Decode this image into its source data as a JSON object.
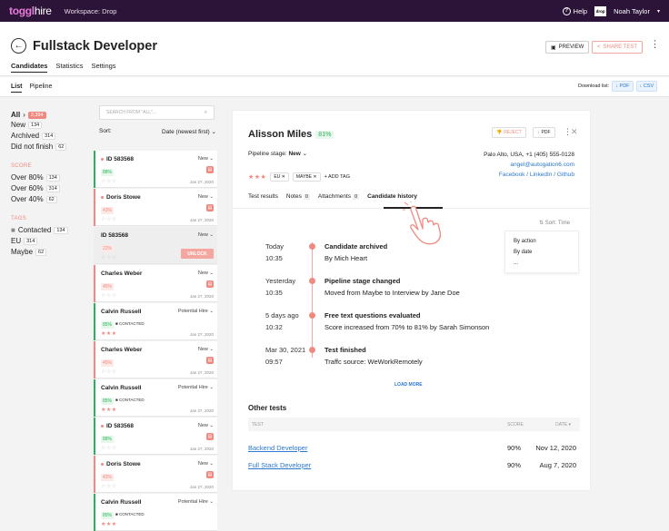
{
  "topbar": {
    "logo_main": "toggl",
    "logo_sub": "hire",
    "workspace": "Workspace: Drop",
    "help": "Help",
    "user_logo": "drop",
    "user": "Noah Taylor"
  },
  "header": {
    "back_icon": "←",
    "title": "Fullstack Developer",
    "tabs": [
      "Candidates",
      "Statistics",
      "Settings"
    ],
    "preview": "PREVIEW",
    "share": "SHARE TEST"
  },
  "subbar": {
    "tabs": [
      "List",
      "Pipeline"
    ],
    "download_label": "Download list:",
    "pdf": "PDF",
    "csv": "CSV"
  },
  "filters": {
    "all": "All",
    "all_count": "2,394",
    "new": "New",
    "new_count": "134",
    "archived": "Archived",
    "archived_count": "314",
    "dnf": "Did not finish",
    "dnf_count": "62",
    "score_head": "SCORE",
    "o80": "Over 80%",
    "o80_count": "134",
    "o60": "Over 60%",
    "o60_count": "314",
    "o40": "Over 40%",
    "o40_count": "62",
    "tags_head": "TAGS",
    "contacted": "Contacted",
    "contacted_count": "134",
    "eu": "EU",
    "eu_count": "314",
    "maybe": "Maybe",
    "maybe_count": "62"
  },
  "list": {
    "search_placeholder": "SEARCH FROM \"ALL\"...",
    "sort_label": "Sort:",
    "sort_value": "Date (newest first)",
    "cards": [
      {
        "name": "ID 583568",
        "status": "New",
        "score": "88%",
        "date": "Jan 27, 2020",
        "contacted": ""
      },
      {
        "name": "Doris Stowe",
        "status": "New",
        "score": "43%",
        "date": "Jan 27, 2020",
        "contacted": ""
      },
      {
        "name": "ID 583568",
        "status": "New",
        "score": "22%",
        "date": "",
        "contacted": "",
        "unlock": "UNLOCK"
      },
      {
        "name": "Charles Weber",
        "status": "New",
        "score": "45%",
        "date": "Jan 27, 2020",
        "contacted": ""
      },
      {
        "name": "Calvin Russell",
        "status": "Potential Hire",
        "score": "85%",
        "date": "Jan 27, 2020",
        "contacted": "CONTACTED"
      },
      {
        "name": "Charles Weber",
        "status": "New",
        "score": "45%",
        "date": "Jan 27, 2020",
        "contacted": ""
      },
      {
        "name": "Calvin Russell",
        "status": "Potential Hire",
        "score": "85%",
        "date": "Jan 27, 2020",
        "contacted": "CONTACTED"
      },
      {
        "name": "ID 583568",
        "status": "New",
        "score": "88%",
        "date": "Jan 27, 2020",
        "contacted": ""
      },
      {
        "name": "Doris Stowe",
        "status": "New",
        "score": "43%",
        "date": "Jan 27, 2020",
        "contacted": ""
      },
      {
        "name": "Calvin Russell",
        "status": "Potential Hire",
        "score": "85%",
        "date": "",
        "contacted": "CONTACTED"
      }
    ]
  },
  "detail": {
    "name": "Alisson Miles",
    "score": "81%",
    "reject": "REJECT",
    "pdf": "PDF",
    "pipeline_label": "Pipeline stage:",
    "pipeline_value": "New",
    "location_phone": "Palo Alto, USA, +1 (405) 555-0128",
    "email": "angel@autogation6.com",
    "social": "Facebook / LinkedIn / Github",
    "tags": [
      "EU",
      "MAYBE"
    ],
    "add_tag": "+ ADD TAG",
    "tabs": {
      "results": "Test results",
      "notes": "Notes",
      "notes_count": "0",
      "attachments": "Attachments",
      "attachments_count": "0",
      "history": "Candidate history"
    },
    "sort_time": "Sort: Time",
    "sort_options": [
      "By action",
      "By date",
      "..."
    ],
    "timeline": [
      {
        "when1": "Today",
        "when2": "10:35",
        "title": "Candidate archived",
        "desc": "By Mich Heart"
      },
      {
        "when1": "Yesterday",
        "when2": "10:35",
        "title": "Pipeline stage changed",
        "desc": "Moved from Maybe to Interview by Jane Doe"
      },
      {
        "when1": "5 days ago",
        "when2": "10:32",
        "title": "Free text questions evaluated",
        "desc": "Score increased from 70% to 81% by Sarah Simonson"
      },
      {
        "when1": "Mar 30, 2021",
        "when2": "09:57",
        "title": "Test finished",
        "desc": "Traffc source: WeWorkRemotely"
      }
    ],
    "load_more": "LOAD MORE",
    "other_title": "Other tests",
    "other_head": {
      "test": "TEST",
      "score": "SCORE",
      "date": "DATE"
    },
    "other_rows": [
      {
        "name": "Backend Developer",
        "score": "90%",
        "date": "Nov 12, 2020"
      },
      {
        "name": "Full Stack Developer",
        "score": "90%",
        "date": "Aug 7, 2020"
      }
    ]
  }
}
